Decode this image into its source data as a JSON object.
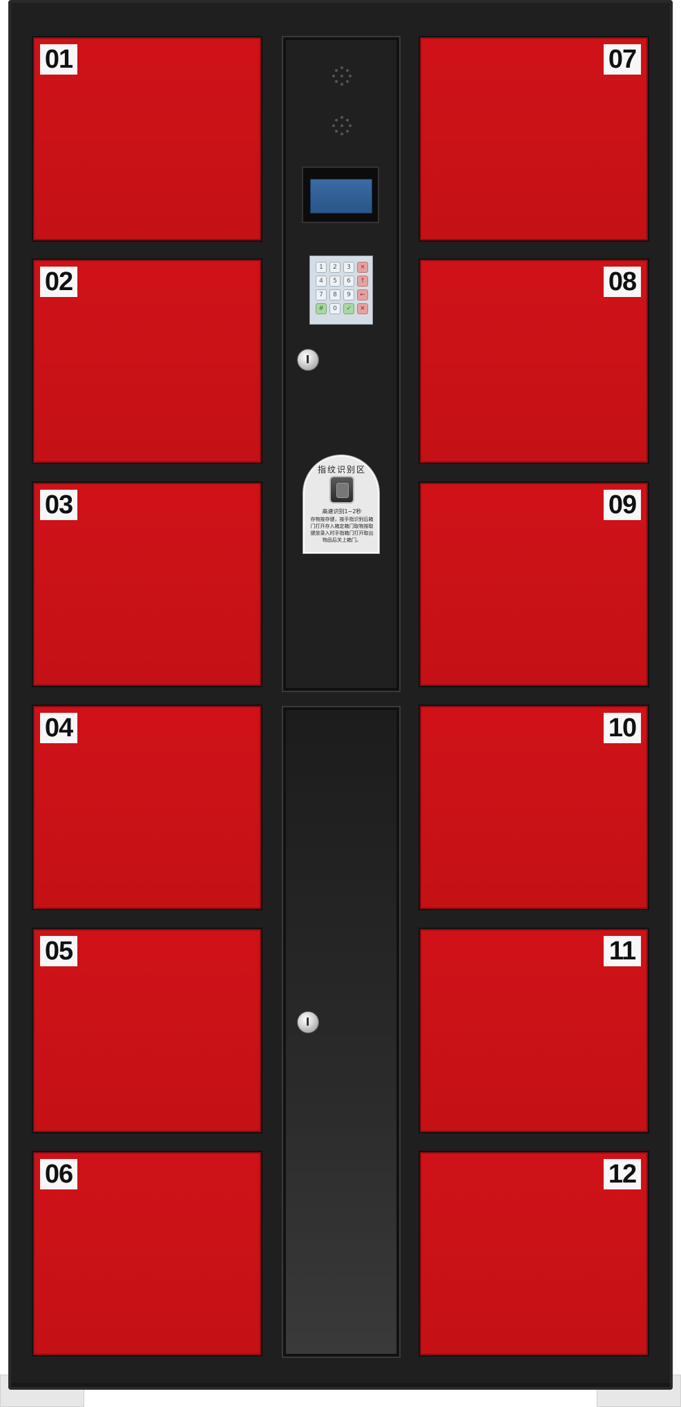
{
  "cabinet": {
    "left_column_numbers": [
      "01",
      "02",
      "03",
      "04",
      "05",
      "06"
    ],
    "right_column_numbers": [
      "07",
      "08",
      "09",
      "10",
      "11",
      "12"
    ],
    "keypad_keys": [
      "1",
      "2",
      "3",
      "×",
      "4",
      "5",
      "6",
      "↑",
      "7",
      "8",
      "9",
      "←",
      "#",
      "0",
      "✓",
      "✕"
    ],
    "fingerprint_plate": {
      "title": "指纹识别区",
      "speed_line": "高速识别1~2秒",
      "instructions": "存物按存键，按手指识别后箱门打开存入箱定箱门取物按取键放录入时手指箱门打开取出物品后关上箱门。"
    },
    "colors": {
      "door_red": "#c8121a",
      "frame_black": "#1f1f1f",
      "screen_blue": "#2f5f97"
    }
  }
}
